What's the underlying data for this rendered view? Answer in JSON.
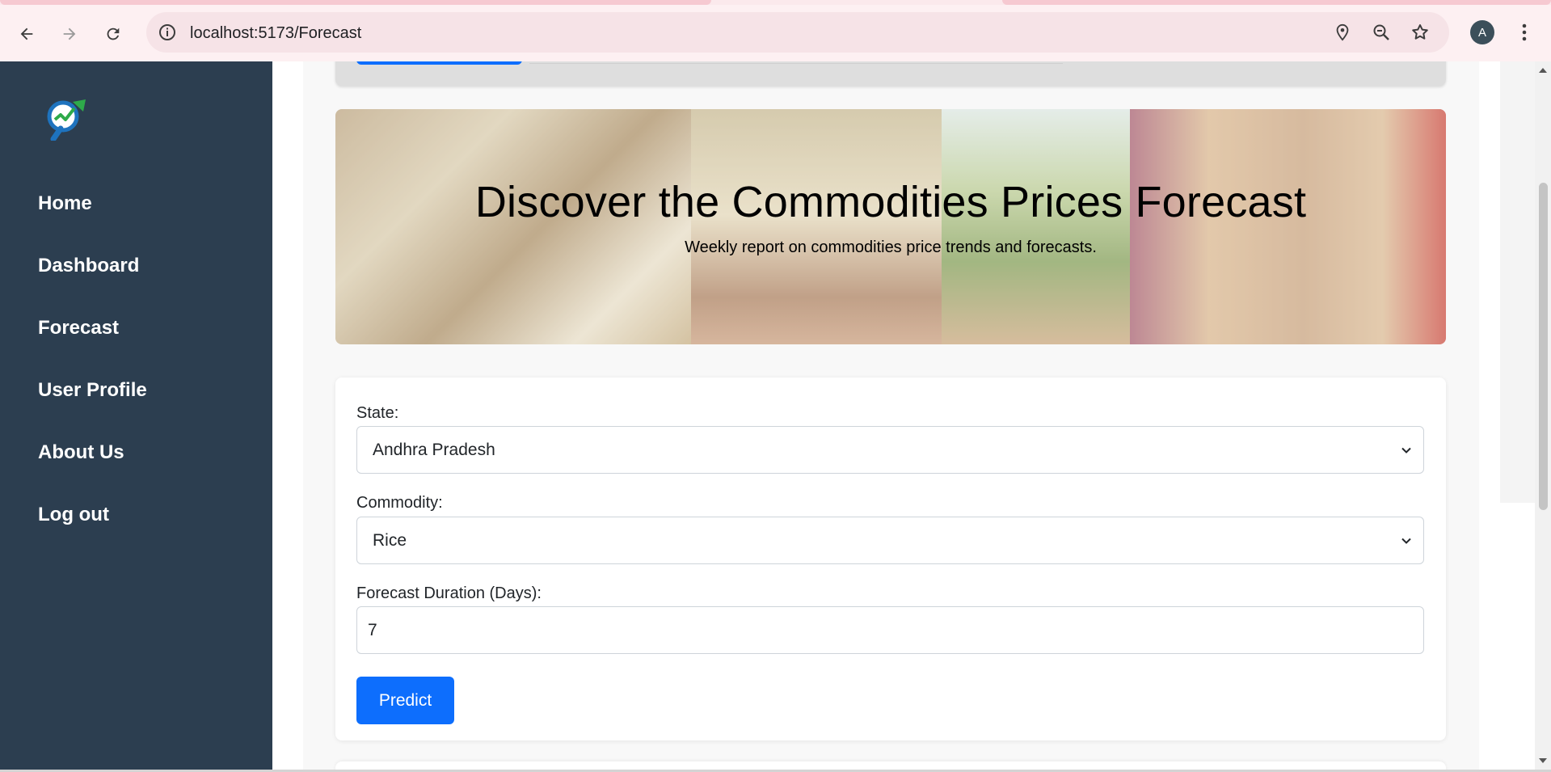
{
  "browser": {
    "url": "localhost:5173/Forecast",
    "profile_initial": "A",
    "icons": [
      "back-arrow-icon",
      "forward-arrow-icon",
      "reload-icon",
      "site-info-icon",
      "location-pin-icon",
      "zoom-icon",
      "bookmark-star-icon",
      "more-vert-icon"
    ]
  },
  "sidebar": {
    "logo_icon": "magnifier-trend-logo",
    "items": [
      {
        "label": "Home"
      },
      {
        "label": "Dashboard"
      },
      {
        "label": "Forecast"
      },
      {
        "label": "User Profile"
      },
      {
        "label": "About Us"
      },
      {
        "label": "Log out"
      }
    ]
  },
  "hero": {
    "title": "Discover the Commodities Prices Forecast",
    "subtitle": "Weekly report on commodities price trends and forecasts."
  },
  "form": {
    "state_label": "State:",
    "state_value": "Andhra Pradesh",
    "commodity_label": "Commodity:",
    "commodity_value": "Rice",
    "duration_label": "Forecast Duration (Days):",
    "duration_value": "7",
    "submit_label": "Predict"
  },
  "colors": {
    "sidebar_bg": "#2c3e50",
    "primary": "#0d6efd",
    "page_bg": "#f8f8f8"
  }
}
